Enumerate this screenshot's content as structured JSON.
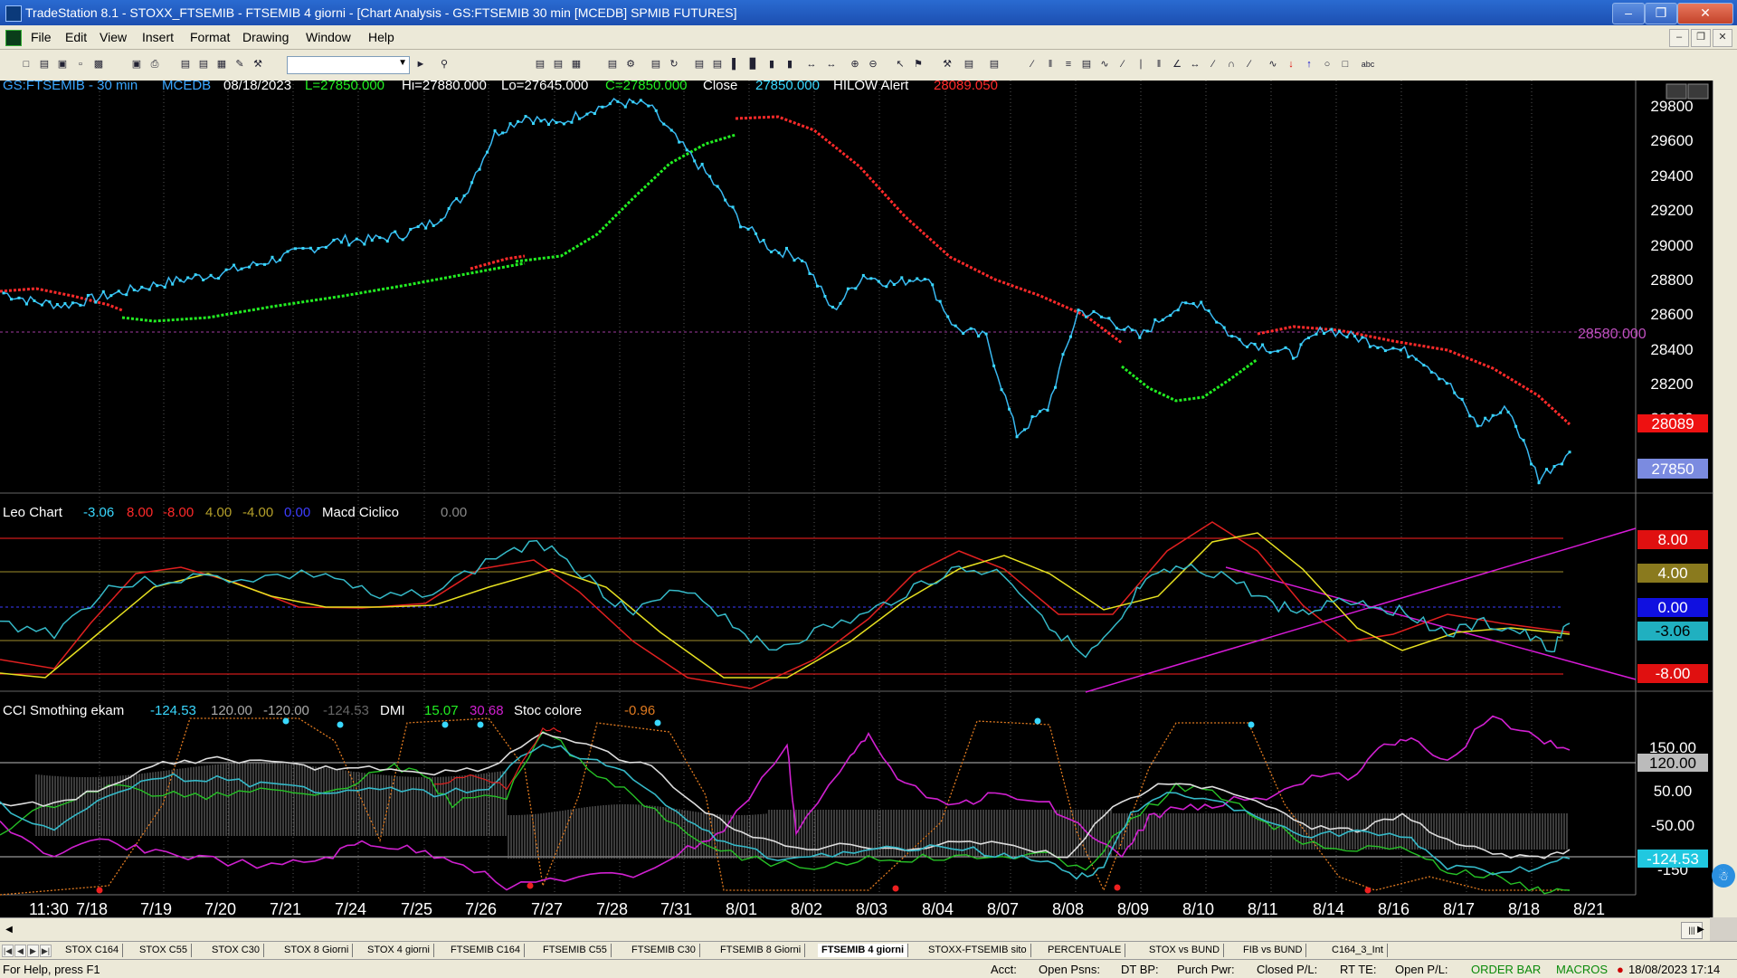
{
  "window": {
    "title": "TradeStation 8.1 - STOXX_FTSEMIB - FTSEMIB  4 giorni - [Chart Analysis - GS:FTSEMIB  30 min  [MCEDB] SPMIB FUTURES]",
    "minimize_icon": "minimize-icon",
    "maximize_icon": "maximize-icon",
    "close_icon": "close-icon"
  },
  "menu": {
    "items": [
      "File",
      "Edit",
      "View",
      "Insert",
      "Format",
      "Drawing",
      "Window",
      "Help"
    ]
  },
  "price_pane": {
    "symbol": "GS:FTSEMIB - 30 min",
    "session": "MCEDB",
    "date": "08/18/2023",
    "last": "L=27850.000",
    "high": "Hi=27880.000",
    "low": "Lo=27645.000",
    "close": "C=27850.000",
    "close_label": "Close",
    "close_value": "27850.000",
    "alert_label": "HILOW Alert",
    "alert_value": "28089.050",
    "hline_label": "28580.000",
    "y_ticks": [
      "29800",
      "29600",
      "29400",
      "29200",
      "29000",
      "28800",
      "28600",
      "28400",
      "28200",
      "28000",
      "27800"
    ],
    "red_tag": "28089",
    "last_tag": "27850"
  },
  "macd_pane": {
    "name": "Leo Chart",
    "v1": "-3.06",
    "v2": "8.00",
    "v3": "-8.00",
    "v4": "4.00",
    "v5": "-4.00",
    "v6": "0.00",
    "name2": "Macd Ciclico",
    "v7": "0.00",
    "tags": [
      "8.00",
      "4.00",
      "0.00",
      "-3.06",
      "-8.00"
    ]
  },
  "cci_pane": {
    "name": "CCI Smothing ekam",
    "v1": "-124.53",
    "v2": "120.00",
    "v3": "-120.00",
    "v4": "-124.53",
    "dmi": "DMI",
    "dmi1": "15.07",
    "dmi2": "30.68",
    "stoc": "Stoc colore",
    "stoc_v": "-0.96",
    "y_ticks": [
      "150.00",
      "50.00",
      "-50.00",
      "-150"
    ],
    "tag120": "120.00",
    "tag_last": "-124.53"
  },
  "x_axis": [
    "11:30",
    "7/18",
    "7/19",
    "7/20",
    "7/21",
    "7/24",
    "7/25",
    "7/26",
    "7/27",
    "7/28",
    "7/31",
    "8/01",
    "8/02",
    "8/03",
    "8/04",
    "8/07",
    "8/08",
    "8/09",
    "8/10",
    "8/11",
    "8/14",
    "8/16",
    "8/17",
    "8/18",
    "8/21"
  ],
  "sheet_tabs": [
    "STOX C164",
    "STOX C55",
    "STOX  C30",
    "STOX  8 Giorni",
    "STOX 4 giorni",
    "FTSEMIB C164",
    "FTSEMIB C55",
    "FTSEMIB C30",
    "FTSEMIB  8 Giorni",
    "FTSEMIB  4 giorni",
    "STOXX-FTSEMIB sito",
    "PERCENTUALE",
    "STOX vs BUND",
    "FIB vs BUND",
    "C164_3_Int"
  ],
  "active_tab": 9,
  "status": {
    "help": "For Help, press F1",
    "acct": "Acct:",
    "open_psns": "Open Psns:",
    "dt_bp": "DT BP:",
    "purch_pwr": "Purch Pwr:",
    "closed_pl": "Closed P/L:",
    "rt_te": "RT TE:",
    "open_pl": "Open P/L:",
    "order_bar": "ORDER BAR",
    "macros": "MACROS",
    "datetime": "18/08/2023 17:14"
  },
  "chart_data": {
    "type": "line",
    "price_axis": {
      "ylim": [
        27700,
        29900
      ]
    },
    "close_approx": [
      28750,
      28700,
      28680,
      28720,
      28760,
      28800,
      28830,
      28860,
      28900,
      28950,
      29000,
      29050,
      29050,
      29080,
      29150,
      29300,
      29650,
      29750,
      29700,
      29780,
      29830,
      29810,
      29600,
      29400,
      29150,
      29000,
      28950,
      28650,
      28850,
      28800,
      28850,
      28550,
      28500,
      27950,
      28100,
      28650,
      28600,
      28500,
      28650,
      28700,
      28500,
      28450,
      28400,
      28550,
      28500,
      28450,
      28400,
      28250,
      28000,
      28100,
      27700,
      27850
    ]
  }
}
